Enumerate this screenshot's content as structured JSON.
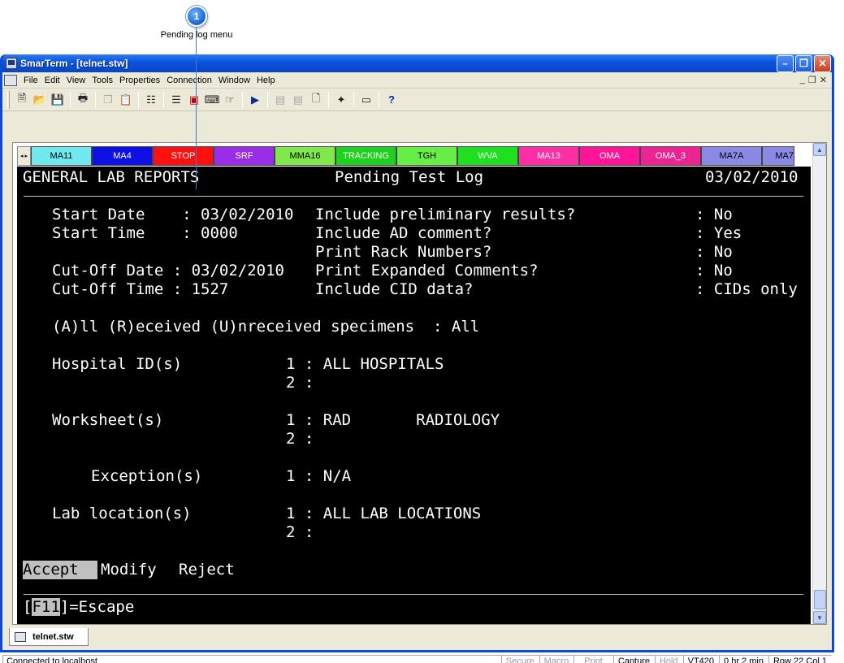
{
  "callout": {
    "number": "1",
    "label": "Pending log menu"
  },
  "window": {
    "title": "SmarTerm - [telnet.stw]",
    "min": "–",
    "max": "❐",
    "close": "✕"
  },
  "menu": {
    "items": [
      "File",
      "Edit",
      "View",
      "Tools",
      "Properties",
      "Connection",
      "Window",
      "Help"
    ],
    "mdi": [
      "_",
      "❐",
      "✕"
    ]
  },
  "macros": {
    "nav": "◂ ▸",
    "buttons": [
      {
        "label": "MA11",
        "bg": "#6fe8ee",
        "fg": "#000000"
      },
      {
        "label": "MA4",
        "bg": "#0f10e6",
        "fg": "#ffffff"
      },
      {
        "label": "STOP",
        "bg": "#ff1010",
        "fg": "#ffffff"
      },
      {
        "label": "SRF",
        "bg": "#9a2ee8",
        "fg": "#ffffff"
      },
      {
        "label": "MMA16",
        "bg": "#80e84a",
        "fg": "#000000"
      },
      {
        "label": "TRACKING",
        "bg": "#20d220",
        "fg": "#ffffff"
      },
      {
        "label": "TGH",
        "bg": "#66ee44",
        "fg": "#000000"
      },
      {
        "label": "WVA",
        "bg": "#1fe01f",
        "fg": "#ffffff"
      },
      {
        "label": "MA13",
        "bg": "#ff2ea6",
        "fg": "#ffffff"
      },
      {
        "label": "OMA",
        "bg": "#ff1498",
        "fg": "#ffffff"
      },
      {
        "label": "OMA_3",
        "bg": "#ee2392",
        "fg": "#ffffff"
      },
      {
        "label": "MA7A",
        "bg": "#8a8ae6",
        "fg": "#000000"
      },
      {
        "label": "MA7",
        "bg": "#8a8ae6",
        "fg": "#000000"
      }
    ]
  },
  "terminal": {
    "header_left": "GENERAL LAB REPORTS",
    "header_center": "Pending Test Log",
    "header_right": "03/02/2010",
    "row1_left": "Start Date    : 03/02/2010",
    "row1_q": "Include preliminary results?",
    "row1_a": ": No",
    "row2_left": "Start Time    : 0000",
    "row2_q": "Include AD comment?",
    "row2_a": ": Yes",
    "row3_q": "Print Rack Numbers?",
    "row3_a": ": No",
    "row4_left": "Cut-Off Date : 03/02/2010",
    "row4_q": "Print Expanded Comments?",
    "row4_a": ": No",
    "row5_left": "Cut-Off Time : 1527",
    "row5_q": "Include CID data?",
    "row5_a": ": CIDs only",
    "specimens": "(A)ll (R)eceived (U)nreceived specimens  : All",
    "hospital_label": "Hospital ID(s)",
    "hospital_1": "1 : ALL HOSPITALS",
    "hospital_2": "2 :",
    "worksheet_label": "Worksheet(s)",
    "worksheet_1": "1 : RAD       RADIOLOGY",
    "worksheet_2": "2 :",
    "exception_label": "Exception(s)",
    "exception_1": "1 : N/A",
    "lab_label": "Lab location(s)",
    "lab_1": "1 : ALL LAB LOCATIONS",
    "lab_2": "2 :",
    "accept": "Accept  ",
    "modify": "Modify",
    "reject": "Reject",
    "bracket_open": "[",
    "f11_key": "F11",
    "escape": "]=Escape"
  },
  "task_tab": "telnet.stw",
  "status": {
    "connection": "Connected to localhost",
    "cells": [
      {
        "text": "Secure",
        "dim": true
      },
      {
        "text": "Macro",
        "dim": true
      },
      {
        "text": "Print",
        "dim": true
      },
      {
        "text": "Capture",
        "dim": false
      },
      {
        "text": "Hold",
        "dim": true
      },
      {
        "text": "VT420",
        "dim": false
      },
      {
        "text": "0 hr 2 min",
        "dim": false
      },
      {
        "text": "Row 22  Col 1",
        "dim": false
      }
    ]
  }
}
